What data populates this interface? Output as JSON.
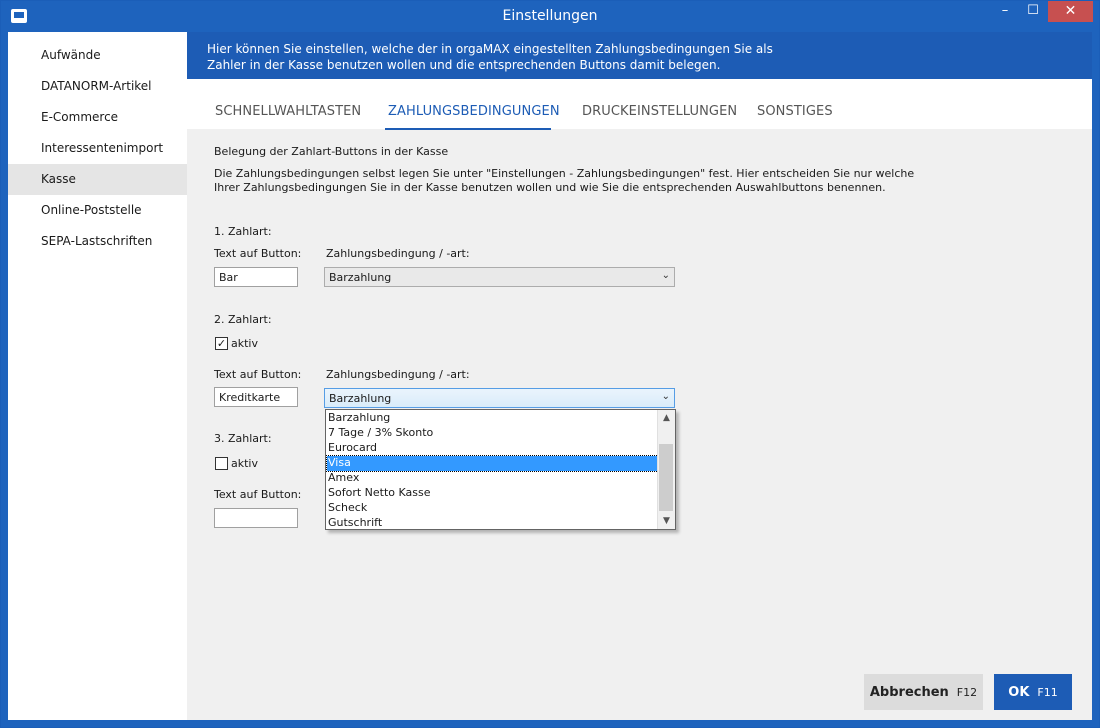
{
  "window": {
    "title": "Einstellungen",
    "minimize": "–",
    "maximize": "☐",
    "close": "✕"
  },
  "sidebar": {
    "items": [
      {
        "label": "Aufwände"
      },
      {
        "label": "DATANORM-Artikel"
      },
      {
        "label": "E-Commerce"
      },
      {
        "label": "Interessentenimport"
      },
      {
        "label": "Kasse"
      },
      {
        "label": "Online-Poststelle"
      },
      {
        "label": "SEPA-Lastschriften"
      }
    ],
    "active": "Kasse"
  },
  "banner": {
    "text": "Hier können Sie einstellen, welche der in orgaMAX eingestellten Zahlungsbedingungen Sie als Zahler in der Kasse benutzen wollen und die entsprechenden Buttons damit belegen."
  },
  "tabs": [
    {
      "label": "SCHNELLWAHLTASTEN"
    },
    {
      "label": "ZAHLUNGSBEDINGUNGEN"
    },
    {
      "label": "DRUCKEINSTELLUNGEN"
    },
    {
      "label": "SONSTIGES"
    }
  ],
  "active_tab": "ZAHLUNGSBEDINGUNGEN",
  "section": {
    "heading": "Belegung der Zahlart-Buttons in der Kasse",
    "description": "Die Zahlungsbedingungen selbst legen Sie unter \"Einstellungen - Zahlungsbedingungen\" fest. Hier entscheiden Sie nur welche Ihrer Zahlungsbedingungen Sie in der Kasse benutzen wollen und wie Sie die entsprechenden Auswahlbuttons benennen."
  },
  "zahlart1": {
    "title": "1. Zahlart:",
    "text_label": "Text auf Button:",
    "cond_label": "Zahlungsbedingung / -art:",
    "text_value": "Bar",
    "cond_value": "Barzahlung"
  },
  "zahlart2": {
    "title": "2. Zahlart:",
    "active_label": "aktiv",
    "active_checked": true,
    "check_mark": "✓",
    "text_label": "Text auf Button:",
    "cond_label": "Zahlungsbedingung / -art:",
    "text_value": "Kreditkarte",
    "cond_value": "Barzahlung"
  },
  "zahlart3": {
    "title": "3. Zahlart:",
    "active_label": "aktiv",
    "active_checked": false,
    "text_label": "Text auf Button:",
    "text_value": ""
  },
  "dropdown": {
    "options": [
      "Barzahlung",
      "7 Tage / 3% Skonto",
      "Eurocard",
      "Visa",
      "Amex",
      "Sofort Netto Kasse",
      "Scheck",
      "Gutschrift"
    ],
    "highlighted": "Visa"
  },
  "buttons": {
    "cancel_label": "Abbrechen",
    "cancel_key": "F12",
    "ok_label": "OK",
    "ok_key": "F11"
  },
  "colors": {
    "accent": "#1d5cb5",
    "close": "#c75050",
    "selection": "#3399ff"
  }
}
